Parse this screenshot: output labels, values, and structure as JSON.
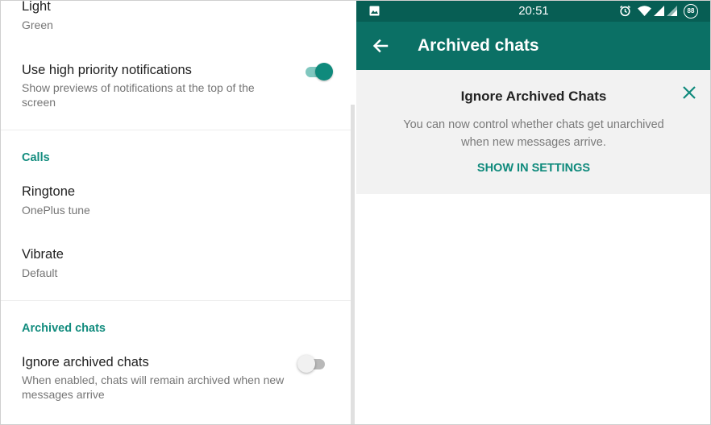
{
  "left_panel": {
    "theme": {
      "title": "Light",
      "subtitle": "Green"
    },
    "high_priority": {
      "title": "Use high priority notifications",
      "subtitle": "Show previews of notifications at the top of the screen",
      "enabled": true
    },
    "calls_section": {
      "header": "Calls"
    },
    "ringtone": {
      "title": "Ringtone",
      "subtitle": "OnePlus tune"
    },
    "vibrate": {
      "title": "Vibrate",
      "subtitle": "Default"
    },
    "archived_section": {
      "header": "Archived chats"
    },
    "ignore_archived": {
      "title": "Ignore archived chats",
      "subtitle": "When enabled, chats will remain archived when new messages arrive",
      "enabled": false
    }
  },
  "right_panel": {
    "status_bar": {
      "time": "20:51",
      "battery": "88",
      "icons": [
        "image-icon",
        "alarm-icon",
        "wifi-icon",
        "signal-icon",
        "signal-icon",
        "battery-icon"
      ]
    },
    "toolbar": {
      "title": "Archived chats",
      "back_icon": "back-arrow-icon"
    },
    "banner": {
      "title": "Ignore Archived Chats",
      "body": "You can now control whether chats get unarchived when new messages arrive.",
      "action": "SHOW IN SETTINGS",
      "close_icon": "close-icon"
    }
  },
  "colors": {
    "accent": "#128c7e",
    "toolbar": "#0b7065",
    "status_bar": "#075e54",
    "banner_bg": "#f2f2f2"
  }
}
